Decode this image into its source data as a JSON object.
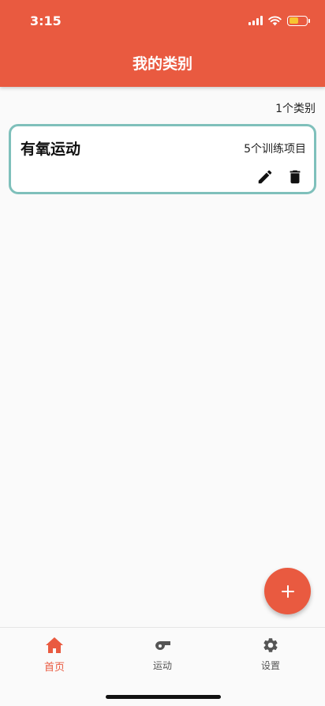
{
  "status_bar": {
    "time": "3:15"
  },
  "appbar": {
    "title": "我的类别"
  },
  "list": {
    "count_label": "1个类别",
    "categories": [
      {
        "name": "有氧运动",
        "subtitle": "5个训练项目"
      }
    ]
  },
  "bottom_nav": {
    "items": [
      {
        "label": "首页",
        "icon": "home-icon",
        "active": true
      },
      {
        "label": "运动",
        "icon": "whistle-icon",
        "active": false
      },
      {
        "label": "设置",
        "icon": "gear-icon",
        "active": false
      }
    ]
  },
  "colors": {
    "primary": "#e95a40",
    "card_border": "#7fc0bb",
    "battery": "#f7c531"
  }
}
